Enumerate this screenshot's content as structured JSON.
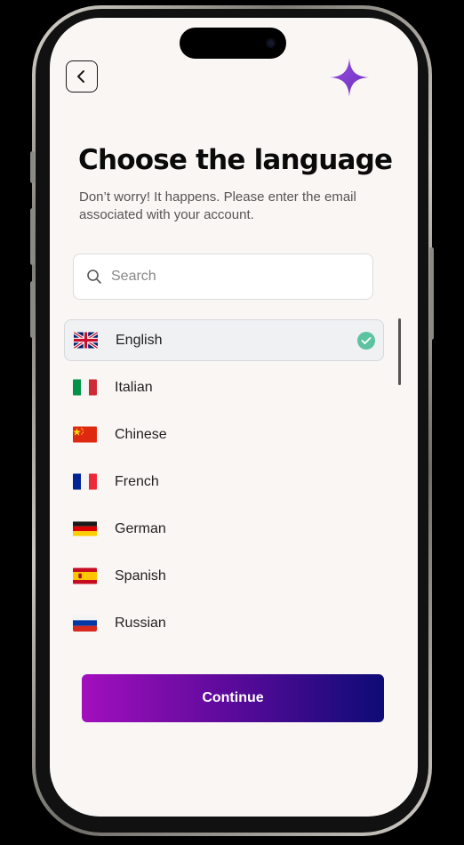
{
  "header": {
    "back_icon": "chevron-left-icon",
    "logo_icon": "sparkle-icon",
    "logo_color": "#7b3fc9"
  },
  "title": "Choose the language",
  "subtitle": "Don’t worry! It happens. Please enter the email associated with your account.",
  "search": {
    "placeholder": "Search",
    "value": ""
  },
  "languages": [
    {
      "label": "English",
      "flag": "uk-flag-icon",
      "selected": true
    },
    {
      "label": "Italian",
      "flag": "italy-flag-icon",
      "selected": false
    },
    {
      "label": "Chinese",
      "flag": "china-flag-icon",
      "selected": false
    },
    {
      "label": "French",
      "flag": "france-flag-icon",
      "selected": false
    },
    {
      "label": "German",
      "flag": "germany-flag-icon",
      "selected": false
    },
    {
      "label": "Spanish",
      "flag": "spain-flag-icon",
      "selected": false
    },
    {
      "label": "Russian",
      "flag": "russia-flag-icon",
      "selected": false
    }
  ],
  "continue_label": "Continue",
  "colors": {
    "check": "#5cc3a0",
    "button_gradient_start": "#a20fbd",
    "button_gradient_end": "#0d0b76",
    "screen_bg": "#faf6f4"
  }
}
